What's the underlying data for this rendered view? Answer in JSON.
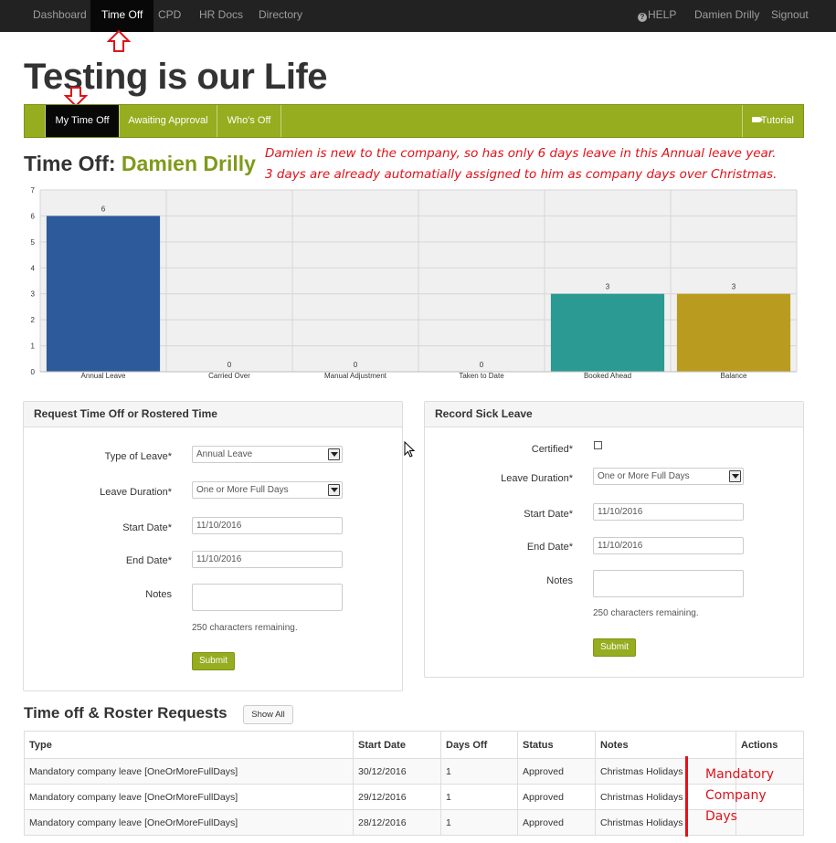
{
  "navbar": {
    "items": [
      "Dashboard",
      "Time Off",
      "CPD",
      "HR Docs",
      "Directory"
    ],
    "right": {
      "help": "HELP",
      "user": "Damien Drilly",
      "signout": "Signout"
    }
  },
  "page_title": "Testing is our Life",
  "subnav": {
    "tabs": [
      "My Time Off",
      "Awaiting Approval",
      "Who's Off"
    ],
    "tutorial": "Tutorial"
  },
  "time_off": {
    "label": "Time Off:",
    "name": "Damien Drilly"
  },
  "annotations": {
    "top_line1": "Damien is new to the company, so has only 6 days leave in this Annual leave year.",
    "top_line2": "3 days are already automatially assigned to him as company days over Christmas.",
    "bottom_line1": "Mandatory",
    "bottom_line2": "Company",
    "bottom_line3": "Days"
  },
  "chart_data": {
    "type": "bar",
    "categories": [
      "Annual Leave",
      "Carried Over",
      "Manual Adjustment",
      "Taken to Date",
      "Booked Ahead",
      "Balance"
    ],
    "values": [
      6,
      0,
      0,
      0,
      3,
      3
    ],
    "ylim": [
      0,
      7
    ],
    "yticks": [
      0,
      1,
      2,
      3,
      4,
      5,
      6,
      7
    ],
    "ytick_labels": [
      "0",
      "1",
      "2",
      "3",
      "4",
      "5",
      "6",
      "7"
    ],
    "colors": [
      "#2d5a9a",
      "#2d5a9a",
      "#2d5a9a",
      "#2d5a9a",
      "#2a9a92",
      "#b99c1f"
    ],
    "grid": true
  },
  "request_form": {
    "title": "Request Time Off or Rostered Time",
    "type_label": "Type of Leave*",
    "type_value": "Annual Leave",
    "duration_label": "Leave Duration*",
    "duration_value": "One or More Full Days",
    "start_label": "Start Date*",
    "start_value": "11/10/2016",
    "end_label": "End Date*",
    "end_value": "11/10/2016",
    "notes_label": "Notes",
    "chars_remaining": "250 characters remaining.",
    "submit": "Submit"
  },
  "sick_form": {
    "title": "Record Sick Leave",
    "certified_label": "Certified*",
    "duration_label": "Leave Duration*",
    "duration_value": "One or More Full Days",
    "start_label": "Start Date*",
    "start_value": "11/10/2016",
    "end_label": "End Date*",
    "end_value": "11/10/2016",
    "notes_label": "Notes",
    "chars_remaining": "250 characters remaining.",
    "submit": "Submit"
  },
  "requests": {
    "title": "Time off & Roster Requests",
    "show_all": "Show All",
    "columns": [
      "Type",
      "Start Date",
      "Days Off",
      "Status",
      "Notes",
      "Actions"
    ],
    "rows": [
      [
        "Mandatory company leave [OneOrMoreFullDays]",
        "30/12/2016",
        "1",
        "Approved",
        "Christmas Holidays",
        ""
      ],
      [
        "Mandatory company leave [OneOrMoreFullDays]",
        "29/12/2016",
        "1",
        "Approved",
        "Christmas Holidays",
        ""
      ],
      [
        "Mandatory company leave [OneOrMoreFullDays]",
        "28/12/2016",
        "1",
        "Approved",
        "Christmas Holidays",
        ""
      ]
    ]
  }
}
